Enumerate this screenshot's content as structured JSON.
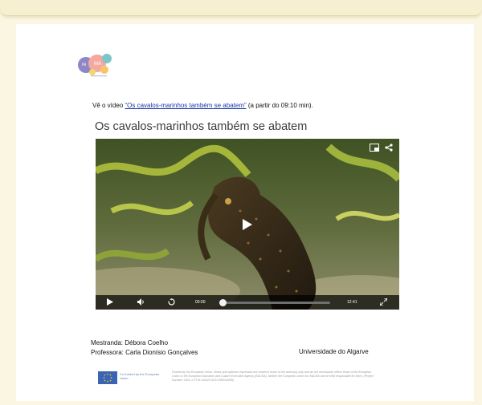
{
  "intro": {
    "prefix": "Vê o vídeo ",
    "link_text": "“Os cavalos-marinhos também se abatem”",
    "suffix": " (a partir do 09:10 min)."
  },
  "video": {
    "title": "Os cavalos-marinhos também se abatem",
    "current_time": "00:00",
    "duration": "12:41",
    "progress": 0.0,
    "icons": [
      "picture-in-picture-icon",
      "share-icon",
      "play-icon",
      "volume-icon",
      "replay-icon",
      "fullscreen-icon"
    ]
  },
  "credits": {
    "student": "Mestranda: Débora Coelho",
    "teacher": "Professora: Carla Dionísio Gonçalves",
    "university": "Universidade do Algarve"
  },
  "footer": {
    "eu_label": "Co-funded by the European Union",
    "disclaimer": "Funded by the European Union. Views and opinions expressed are however those of the author(s) only and do not necessarily reflect those of the European Union or the European Education and Culture Executive Agency (EACEA). Neither the European Union nor EACEA can be held responsible for them. (Project Number: 2021-1-PT01-KA220-SCH-000034369)"
  },
  "colors": {
    "background": "#fbf6e2",
    "link": "#1a35a8",
    "eu_blue": "#3c64b4"
  }
}
